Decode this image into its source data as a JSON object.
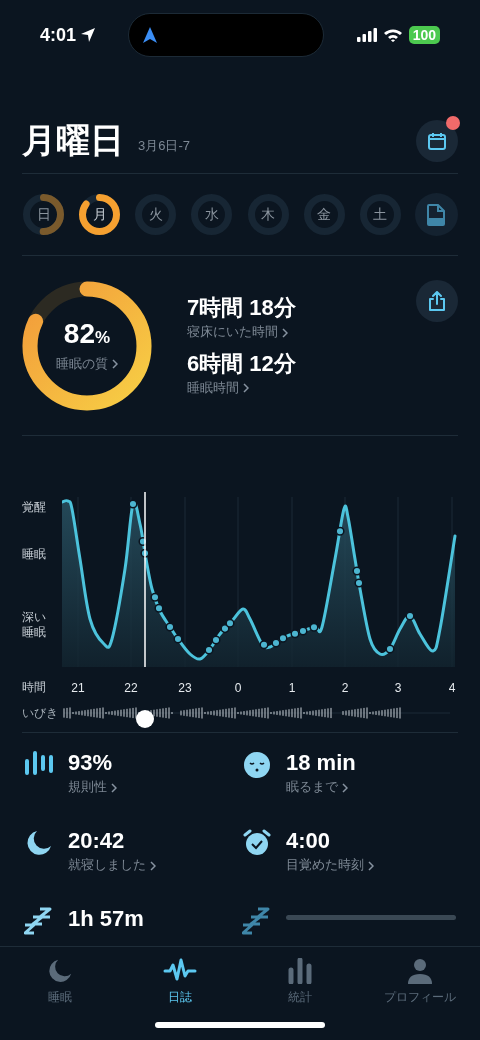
{
  "status_bar": {
    "time": "4:01",
    "battery": "100"
  },
  "header": {
    "title": "月曜日",
    "date_range": "3月6日-7",
    "calendar_badge": true
  },
  "days": [
    {
      "label": "日",
      "selected": false,
      "kind": "recorded"
    },
    {
      "label": "月",
      "selected": true,
      "kind": "recorded"
    },
    {
      "label": "火",
      "selected": false,
      "kind": "empty"
    },
    {
      "label": "水",
      "selected": false,
      "kind": "empty"
    },
    {
      "label": "木",
      "selected": false,
      "kind": "empty"
    },
    {
      "label": "金",
      "selected": false,
      "kind": "empty"
    },
    {
      "label": "土",
      "selected": false,
      "kind": "empty"
    }
  ],
  "summary": {
    "quality": {
      "value": "82",
      "unit": "%",
      "label": "睡眠の質"
    },
    "durations": [
      {
        "value": "7時間 18分",
        "label": "寝床にいた時間"
      },
      {
        "value": "6時間 12分",
        "label": "睡眠時間"
      }
    ]
  },
  "hypnogram": {
    "y_labels": [
      "覚醒",
      "睡眠",
      "深い睡眠"
    ],
    "x_title": "時間",
    "x_labels": [
      "21",
      "22",
      "23",
      "0",
      "1",
      "2",
      "3",
      "4"
    ],
    "snore_label": "いびき"
  },
  "stats": [
    {
      "kind": "bars",
      "value": "93%",
      "label": "規則性"
    },
    {
      "kind": "face",
      "value": "18 min",
      "label": "眠るまで"
    },
    {
      "kind": "moon",
      "value": "20:42",
      "label": "就寝しました"
    },
    {
      "kind": "alarm",
      "value": "4:00",
      "label": "目覚めた時刻"
    },
    {
      "kind": "zzz",
      "value": "1h 57m"
    },
    {
      "kind": "loading"
    }
  ],
  "tabs": [
    {
      "kind": "moon",
      "label": "睡眠",
      "selected": false
    },
    {
      "kind": "wave",
      "label": "日誌",
      "selected": true
    },
    {
      "kind": "stats",
      "label": "統計",
      "selected": false
    },
    {
      "kind": "person",
      "label": "プロフィール",
      "selected": false
    }
  ]
}
